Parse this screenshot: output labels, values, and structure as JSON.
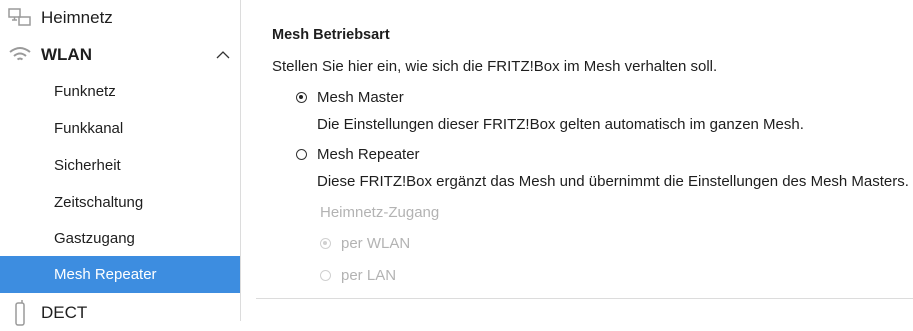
{
  "sidebar": {
    "items": [
      {
        "label": "Heimnetz",
        "icon": "network-icon"
      },
      {
        "label": "WLAN",
        "icon": "wifi-icon",
        "expanded": true
      },
      {
        "label": "DECT",
        "icon": "phone-icon"
      }
    ],
    "subitems": [
      {
        "label": "Funknetz"
      },
      {
        "label": "Funkkanal"
      },
      {
        "label": "Sicherheit"
      },
      {
        "label": "Zeitschaltung"
      },
      {
        "label": "Gastzugang"
      },
      {
        "label": "Mesh Repeater",
        "active": true
      }
    ]
  },
  "main": {
    "section_title": "Mesh Betriebsart",
    "description": "Stellen Sie hier ein, wie sich die FRITZ!Box im Mesh verhalten soll.",
    "options": [
      {
        "label": "Mesh Master",
        "description": "Die Einstellungen dieser FRITZ!Box gelten automatisch im ganzen Mesh.",
        "selected": true
      },
      {
        "label": "Mesh Repeater",
        "description": "Diese FRITZ!Box ergänzt das Mesh und übernimmt die Einstellungen des Mesh Masters.",
        "selected": false
      }
    ],
    "access": {
      "title": "Heimnetz-Zugang",
      "options": [
        {
          "label": "per WLAN",
          "selected": true,
          "disabled": true
        },
        {
          "label": "per LAN",
          "selected": false,
          "disabled": true
        }
      ]
    }
  },
  "colors": {
    "accent": "#3d8de0",
    "disabled": "#b3b3b3"
  }
}
